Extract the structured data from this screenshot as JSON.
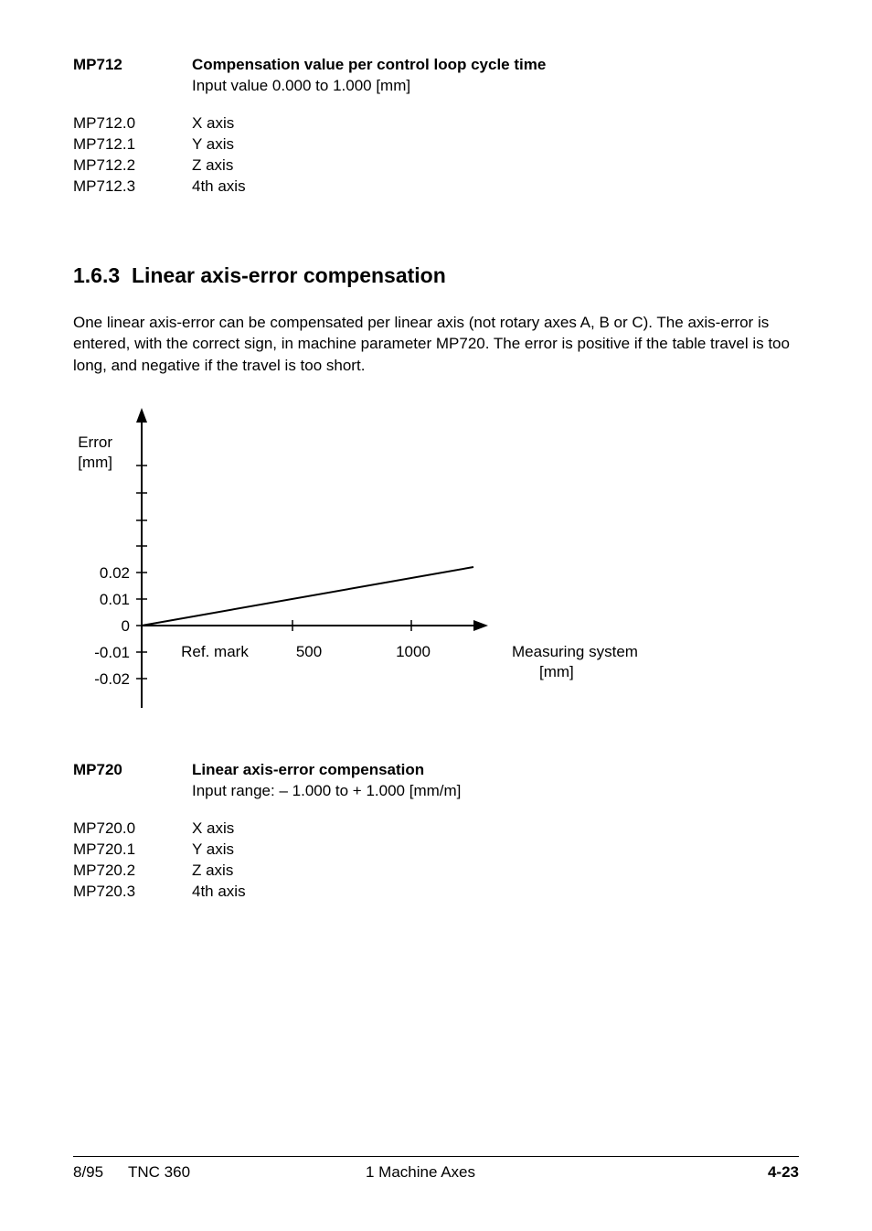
{
  "mp712": {
    "id": "MP712",
    "title": "Compensation value per control loop cycle time",
    "sub": "Input value 0.000 to 1.000 [mm]",
    "items": [
      {
        "id": "MP712.0",
        "label": "X axis"
      },
      {
        "id": "MP712.1",
        "label": "Y axis"
      },
      {
        "id": "MP712.2",
        "label": "Z axis"
      },
      {
        "id": "MP712.3",
        "label": "4th axis"
      }
    ]
  },
  "section": {
    "number": "1.6.3",
    "title": "Linear axis-error compensation",
    "body": "One linear axis-error can be compensated per linear axis (not rotary axes A, B or C). The axis-error is entered, with the correct sign, in machine parameter MP720. The error is positive if the table travel is too long, and negative if the travel is too short."
  },
  "chart_data": {
    "type": "line",
    "ylabel_line1": "Error",
    "ylabel_line2": "[mm]",
    "xlabel_line1": "Measuring system",
    "xlabel_line2": "[mm]",
    "x_origin_label": "Ref. mark",
    "x_ticks": [
      500,
      1000
    ],
    "y_ticks": [
      -0.02,
      -0.01,
      0,
      0.01,
      0.02
    ],
    "ylim": [
      -0.02,
      0.05
    ],
    "series": [
      {
        "name": "error",
        "points": [
          {
            "x": 0,
            "y": 0
          },
          {
            "x": 1100,
            "y": 0.022
          }
        ]
      }
    ]
  },
  "mp720": {
    "id": "MP720",
    "title": "Linear axis-error compensation",
    "sub": "Input range: – 1.000 to + 1.000 [mm/m]",
    "items": [
      {
        "id": "MP720.0",
        "label": "X axis"
      },
      {
        "id": "MP720.1",
        "label": "Y axis"
      },
      {
        "id": "MP720.2",
        "label": "Z axis"
      },
      {
        "id": "MP720.3",
        "label": "4th axis"
      }
    ]
  },
  "footer": {
    "date": "8/95",
    "model": "TNC 360",
    "chapter": "1  Machine Axes",
    "page": "4-23"
  }
}
